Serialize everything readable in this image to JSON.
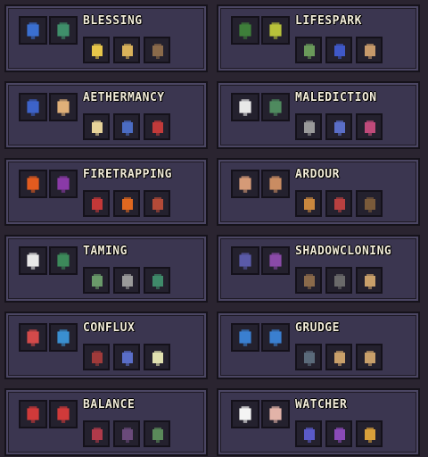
{
  "panels": [
    {
      "title": "BLESSING",
      "big": [
        "#3a6fd0",
        "#3f8f6a"
      ],
      "small": [
        "#e7c64a",
        "#d9b25a",
        "#8a6a4a"
      ]
    },
    {
      "title": "LIFESPARK",
      "big": [
        "#3e7f3a",
        "#b8c23a"
      ],
      "small": [
        "#6a9a5a",
        "#3f58c8",
        "#c79a6a"
      ]
    },
    {
      "title": "AETHERMANCY",
      "big": [
        "#3d63c9",
        "#e0b079"
      ],
      "small": [
        "#e8d49a",
        "#4b6cc3",
        "#c23a3a"
      ]
    },
    {
      "title": "MALEDICTION",
      "big": [
        "#e8e8e8",
        "#4f8a5f"
      ],
      "small": [
        "#9a9a9a",
        "#5a6ec8",
        "#c04a7a"
      ]
    },
    {
      "title": "FIRETRAPPING",
      "big": [
        "#e25b1f",
        "#8a3aa7"
      ],
      "small": [
        "#c43838",
        "#e06820",
        "#b34a38"
      ]
    },
    {
      "title": "ARDOUR",
      "big": [
        "#d59a77",
        "#c98c62"
      ],
      "small": [
        "#c9873e",
        "#b84040",
        "#7a5a3a"
      ]
    },
    {
      "title": "TAMING",
      "big": [
        "#e8e8e8",
        "#3c8a5a"
      ],
      "small": [
        "#6a9a6a",
        "#9a9a9a",
        "#3f8a6a"
      ]
    },
    {
      "title": "SHADOWCLONING",
      "big": [
        "#5a5aa8",
        "#8a4aa8"
      ],
      "small": [
        "#8a6a4a",
        "#6a6a6a",
        "#c9a06a"
      ]
    },
    {
      "title": "CONFLUX",
      "big": [
        "#d34a4a",
        "#3a8fd0"
      ],
      "small": [
        "#a03a3a",
        "#5a6ec8",
        "#e0e0b0"
      ]
    },
    {
      "title": "GRUDGE",
      "big": [
        "#3a7fd0",
        "#3a7fd0"
      ],
      "small": [
        "#5a6a7a",
        "#c9a06a",
        "#c9a06a"
      ]
    },
    {
      "title": "BALANCE",
      "big": [
        "#d03a3a",
        "#d03a3a"
      ],
      "small": [
        "#b03a4a",
        "#6a4a7a",
        "#5a8a5a"
      ]
    },
    {
      "title": "WATCHER",
      "big": [
        "#f4f4f4",
        "#e2b3a8"
      ],
      "small": [
        "#5a5ac8",
        "#8a4ab8",
        "#d9a03a"
      ]
    }
  ]
}
